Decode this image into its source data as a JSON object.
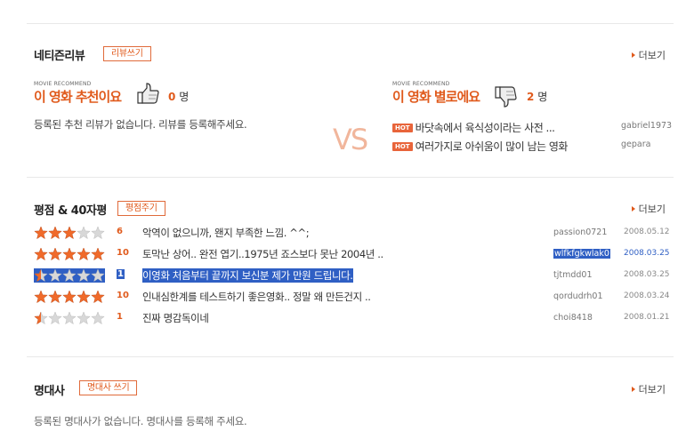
{
  "netizen_review": {
    "title": "네티즌리뷰",
    "write_label": "리뷰쓰기",
    "more_label": "더보기",
    "recommend": {
      "caption": "MOVIE RECOMMEND",
      "title": "이 영화 추천이요",
      "count": "0",
      "unit": "명",
      "empty_message": "등록된 추천 리뷰가 없습니다. 리뷰를 등록해주세요."
    },
    "vs_label": "VS",
    "not_recommend": {
      "caption": "MOVIE RECOMMEND",
      "title": "이 영화 별로에요",
      "count": "2",
      "unit": "명",
      "items": [
        {
          "badge": "HOT",
          "text": "바닷속에서 육식성이라는 사전 ...",
          "user": "gabriel1973"
        },
        {
          "badge": "HOT",
          "text": "여러가지로 아쉬움이 많이 남는 영화",
          "user": "gepara"
        }
      ]
    }
  },
  "ratings": {
    "title": "평점 & 40자평",
    "write_label": "평점주기",
    "more_label": "더보기",
    "rows": [
      {
        "stars": 3,
        "score": "6",
        "comment": "악역이 없으니까, 왠지 부족한 느낌. ^^;",
        "user": "passion0721",
        "date": "2008.05.12"
      },
      {
        "stars": 5,
        "score": "10",
        "comment": "토막난 상어.. 완전 엽기..1975년 죠스보다 못난 2004년 ..",
        "user": "wlfkfgkwlak0",
        "date": "2008.03.25"
      },
      {
        "stars": 0.5,
        "score": "1",
        "comment": "이영화 처음부터 끝까지 보신분 제가 만원 드립니다.",
        "user": "tjtmdd01",
        "date": "2008.03.25"
      },
      {
        "stars": 5,
        "score": "10",
        "comment": "인내심한계를 테스트하기 좋은영화.. 정말 왜 만든건지 ..",
        "user": "qordudrh01",
        "date": "2008.03.24"
      },
      {
        "stars": 0.5,
        "score": "1",
        "comment": "진짜 명감독이네",
        "user": "choi8418",
        "date": "2008.01.21"
      }
    ]
  },
  "famous_lines": {
    "title": "명대사",
    "write_label": "명대사 쓰기",
    "more_label": "더보기",
    "empty_message": "등록된 명대사가 없습니다. 명대사를 등록해 주세요."
  },
  "colors": {
    "accent": "#e05a1c",
    "star": "#f06a2a",
    "star_empty": "#d8d8d8",
    "selection": "#2f5fc4"
  }
}
